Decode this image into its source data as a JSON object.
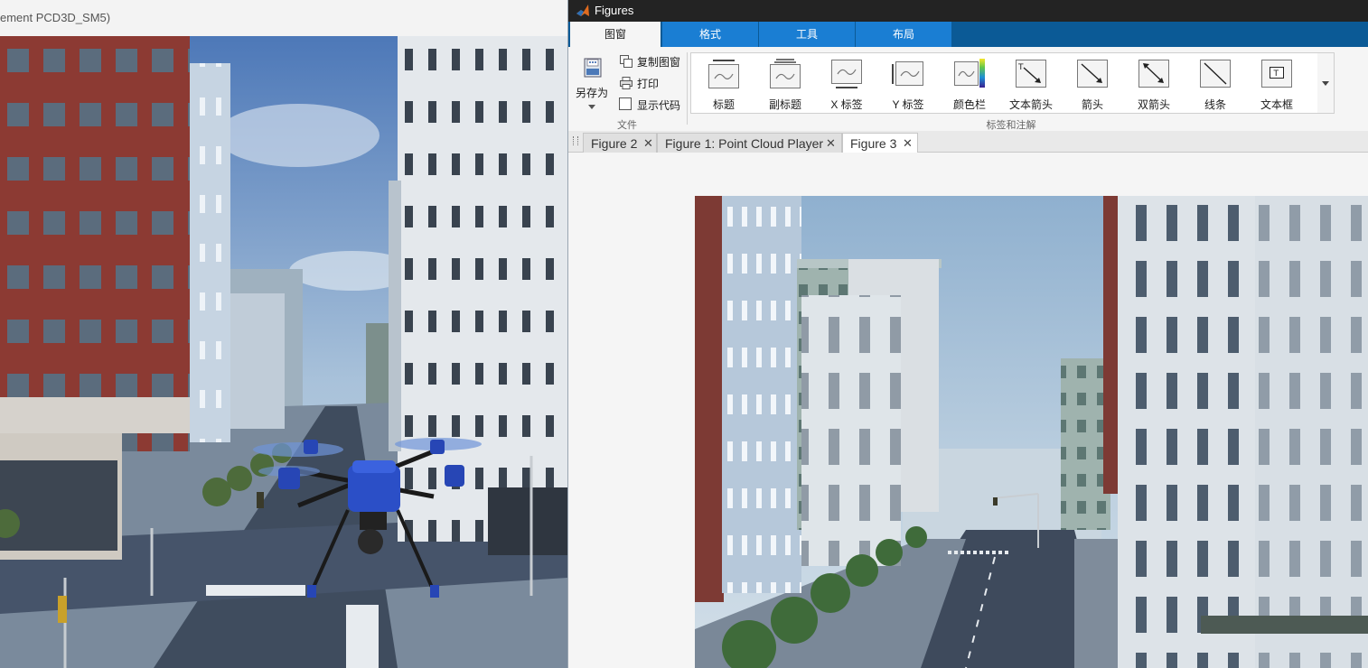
{
  "simulation_window": {
    "title": "ement PCD3D_SM5)"
  },
  "figures_window": {
    "title": "Figures",
    "ribbon_tabs": [
      {
        "label": "图窗",
        "active": true
      },
      {
        "label": "格式",
        "active": false
      },
      {
        "label": "工具",
        "active": false
      },
      {
        "label": "布局",
        "active": false
      }
    ],
    "file_section": {
      "label": "文件",
      "save_as": "另存为",
      "copy_figure": "复制图窗",
      "print": "打印",
      "show_code": "显示代码",
      "show_code_checked": false
    },
    "annotations_section": {
      "label": "标签和注解",
      "items": [
        {
          "label": "标题",
          "icon": "title-icon"
        },
        {
          "label": "副标题",
          "icon": "subtitle-icon"
        },
        {
          "label": "X 标签",
          "icon": "xlabel-icon"
        },
        {
          "label": "Y 标签",
          "icon": "ylabel-icon"
        },
        {
          "label": "颜色栏",
          "icon": "colorbar-icon"
        },
        {
          "label": "文本箭头",
          "icon": "text-arrow-icon"
        },
        {
          "label": "箭头",
          "icon": "arrow-icon"
        },
        {
          "label": "双箭头",
          "icon": "double-arrow-icon"
        },
        {
          "label": "线条",
          "icon": "line-icon"
        },
        {
          "label": "文本框",
          "icon": "textbox-icon"
        }
      ]
    },
    "document_tabs": [
      {
        "label": "Figure 2",
        "active": false
      },
      {
        "label": "Figure 1: Point Cloud Player",
        "active": false
      },
      {
        "label": "Figure 3",
        "active": true
      }
    ],
    "colors": {
      "titlebar": "#232323",
      "ribbon_tab_strip": "#0b5a96",
      "ribbon_tab": "#1a7ed3",
      "background": "#f5f5f5"
    }
  }
}
